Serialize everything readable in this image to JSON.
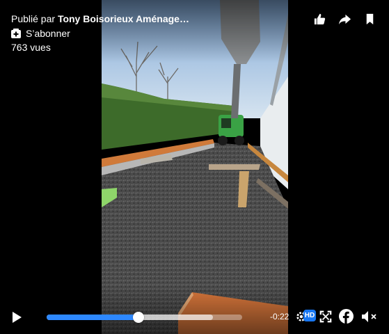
{
  "header": {
    "posted_prefix": "Publié par ",
    "author": "Tony Boisorieux Aménage…",
    "subscribe_label": "S’abonner",
    "views": "763 vues"
  },
  "top_actions": {
    "icons": [
      "like-icon",
      "share-icon",
      "bookmark-icon"
    ]
  },
  "controls": {
    "time_remaining": "-0:22",
    "played_fraction": 0.47,
    "buffered_fraction": 0.85,
    "hd_label": "HD",
    "icons": [
      "play-icon",
      "settings-icon",
      "fullscreen-icon",
      "facebook-icon",
      "volume-muted-icon"
    ]
  },
  "colors": {
    "accent": "#2d88ff",
    "hd_badge": "#1877f2",
    "hedge": "#3d6b2a",
    "sky": "#b9d2ea",
    "gravel": "#4d4d4d",
    "orange_board": "#d07a3a",
    "tractor": "#3aa245"
  }
}
